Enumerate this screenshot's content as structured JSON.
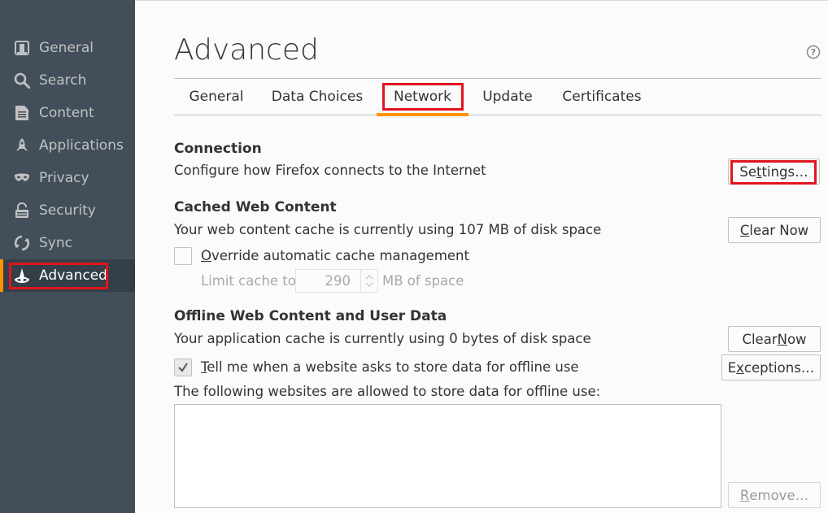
{
  "sidebar": {
    "items": [
      {
        "label": "General",
        "icon": "general-icon"
      },
      {
        "label": "Search",
        "icon": "search-icon"
      },
      {
        "label": "Content",
        "icon": "content-icon"
      },
      {
        "label": "Applications",
        "icon": "applications-icon"
      },
      {
        "label": "Privacy",
        "icon": "privacy-mask-icon"
      },
      {
        "label": "Security",
        "icon": "security-lock-icon"
      },
      {
        "label": "Sync",
        "icon": "sync-icon"
      },
      {
        "label": "Advanced",
        "icon": "advanced-wizard-hat-icon",
        "active": true
      }
    ]
  },
  "page": {
    "title": "Advanced",
    "help_icon": "help-icon"
  },
  "tabs": [
    {
      "label": "General"
    },
    {
      "label": "Data Choices"
    },
    {
      "label": "Network",
      "selected": true
    },
    {
      "label": "Update"
    },
    {
      "label": "Certificates"
    }
  ],
  "connection": {
    "heading": "Connection",
    "description": "Configure how Firefox connects to the Internet",
    "settings_button": {
      "pre": "Se",
      "accel": "t",
      "post": "tings…"
    }
  },
  "cache": {
    "heading": "Cached Web Content",
    "description": "Your web content cache is currently using 107 MB of disk space",
    "clear_button": {
      "pre": "",
      "accel": "C",
      "post": "lear Now"
    },
    "override_checkbox": {
      "pre": "",
      "accel": "O",
      "post": "verride automatic cache management",
      "checked": false
    },
    "limit_label": "Limit cache to",
    "limit_value": "290",
    "limit_unit": "MB of space"
  },
  "offline": {
    "heading": "Offline Web Content and User Data",
    "description": "Your application cache is currently using 0 bytes of disk space",
    "clear_button": {
      "pre": "Clear ",
      "accel": "N",
      "post": "ow"
    },
    "tell_checkbox": {
      "pre": "",
      "accel": "T",
      "post": "ell me when a website asks to store data for offline use",
      "checked": true
    },
    "exceptions_button": {
      "pre": "E",
      "accel": "x",
      "post": "ceptions…"
    },
    "list_label": "The following websites are allowed to store data for offline use:",
    "remove_button": {
      "pre": "",
      "accel": "R",
      "post": "emove…",
      "disabled": true
    }
  },
  "colors": {
    "sidebar_bg": "#424f5a",
    "accent": "#ff9500",
    "highlight_box": "#e0151f"
  }
}
